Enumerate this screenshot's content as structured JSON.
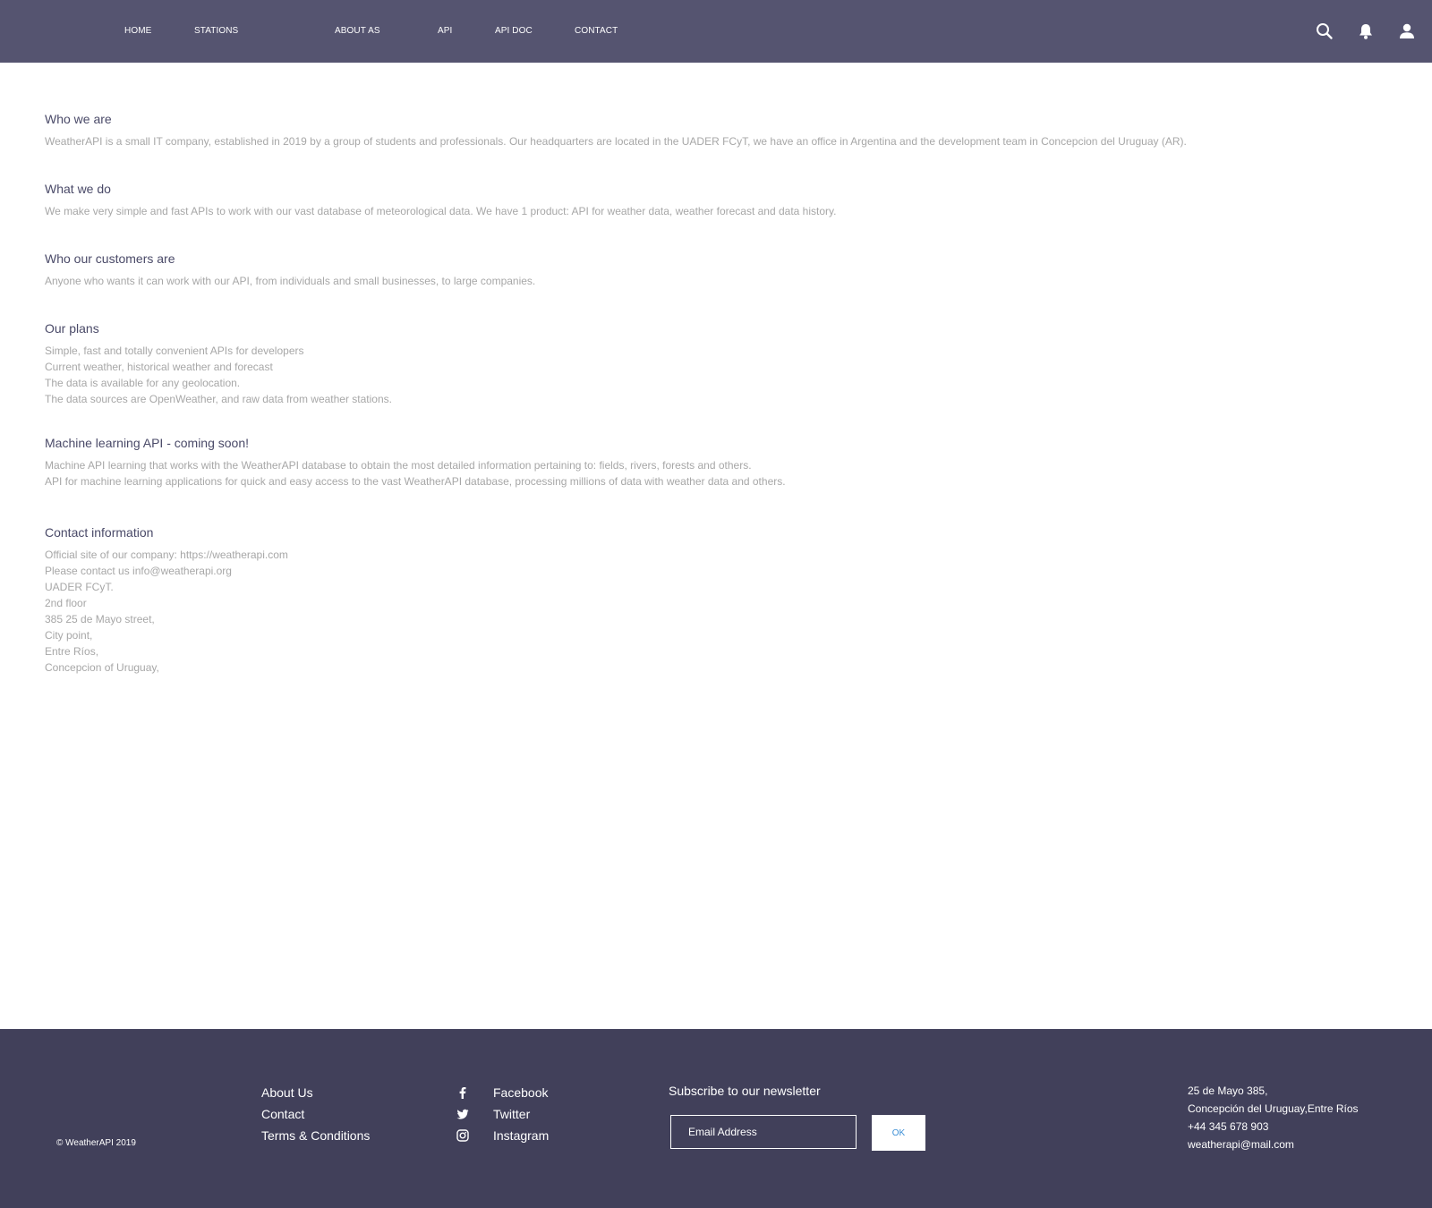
{
  "header": {
    "nav": [
      {
        "label": "HOME"
      },
      {
        "label": "STATIONS"
      },
      {
        "label": "ABOUT AS"
      },
      {
        "label": "API"
      },
      {
        "label": "API DOC"
      },
      {
        "label": "CONTACT"
      }
    ],
    "icons": [
      "search-icon",
      "bell-icon",
      "user-icon"
    ],
    "background": "#555470"
  },
  "main": {
    "sections": [
      {
        "title": "Who we are",
        "lines": [
          "WeatherAPI is a small IT company, established in 2019 by a group of students and professionals. Our headquarters are located in the UADER FCyT, we have an office in Argentina and the development team in Concepcion del Uruguay (AR)."
        ]
      },
      {
        "title": "What we do",
        "lines": [
          "We make very simple and fast APIs to work with our vast database of meteorological data. We have 1 product: API for weather data, weather forecast and data history."
        ]
      },
      {
        "title": "Who our customers are",
        "lines": [
          "Anyone who wants it can work with our API, from individuals and small businesses, to large companies."
        ]
      },
      {
        "title": "Our plans",
        "lines": [
          "Simple, fast and totally convenient APIs for developers",
          "Current weather, historical weather and forecast",
          "The data is available for any geolocation.",
          "The data sources are OpenWeather, and raw data from weather stations."
        ]
      },
      {
        "title": "Machine learning API - coming soon!",
        "lines": [
          "Machine API learning that works with the WeatherAPI database to obtain the most detailed information pertaining to: fields, rivers, forests and others.",
          "API for machine learning applications for quick and easy access to the vast WeatherAPI database, processing millions of data with weather data and others."
        ]
      },
      {
        "title": "Contact information",
        "lines": [
          "Official site of our company: https://weatherapi.com",
          "Please contact us info@weatherapi.org",
          "UADER FCyT.",
          "2nd floor",
          "385 25 de Mayo street,",
          "City point,",
          "Entre Ríos,",
          "Concepcion of Uruguay,"
        ]
      }
    ]
  },
  "footer": {
    "copyright": "© WeatherAPI 2019",
    "links": [
      {
        "label": "About Us"
      },
      {
        "label": "Contact"
      },
      {
        "label": "Terms & Conditions"
      }
    ],
    "social": [
      {
        "label": "Facebook",
        "icon": "facebook-icon"
      },
      {
        "label": "Twitter",
        "icon": "twitter-icon"
      },
      {
        "label": "Instagram",
        "icon": "instagram-icon"
      }
    ],
    "newsletter": {
      "title": "Subscribe to our newsletter",
      "placeholder": "Email Address",
      "button": "OK"
    },
    "address": [
      "25 de Mayo 385,",
      "Concepción del Uruguay,Entre Ríos",
      "+44 345 678 903",
      "weatherapi@mail.com"
    ],
    "background": "#41405a"
  }
}
